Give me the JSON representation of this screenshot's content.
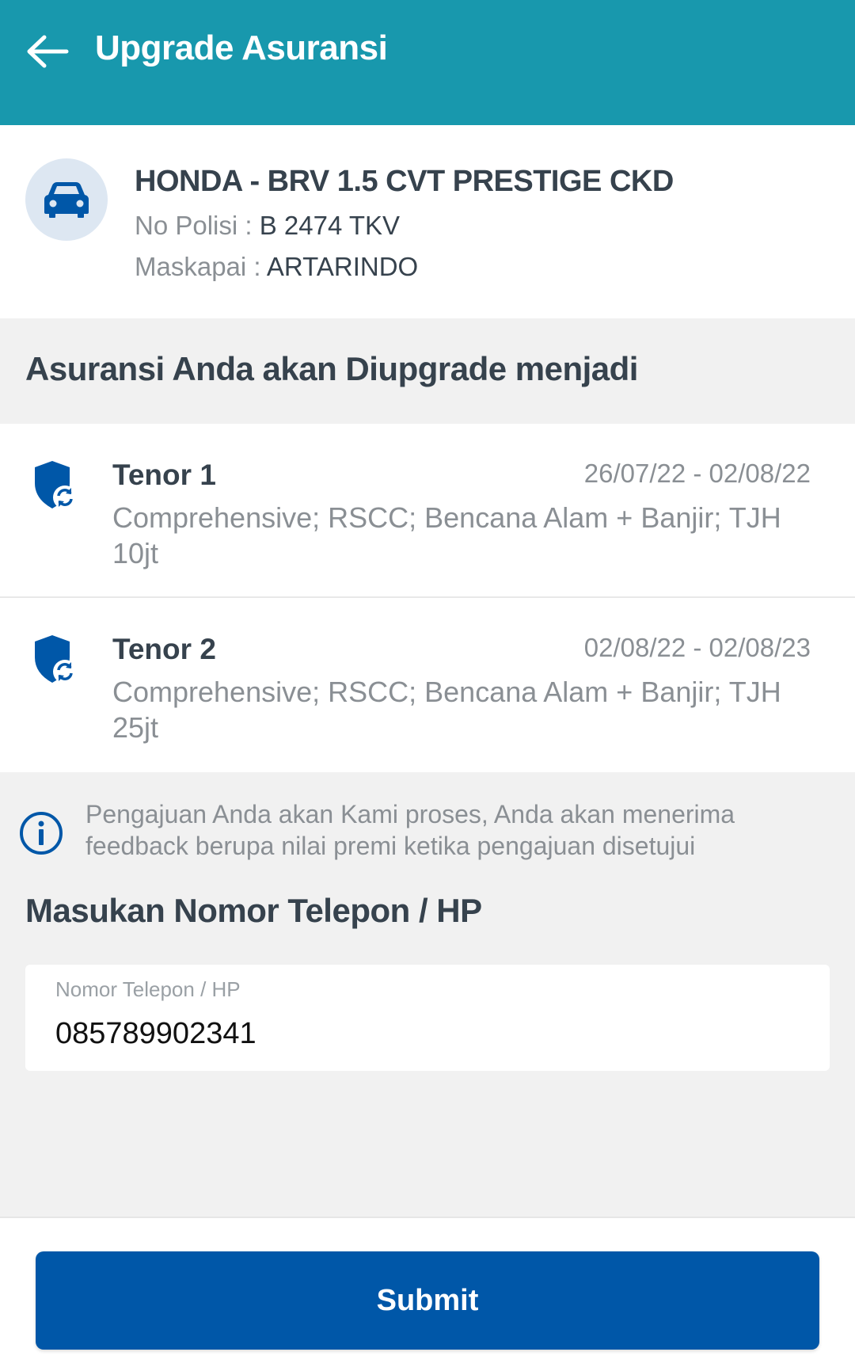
{
  "appbar": {
    "title": "Upgrade Asuransi",
    "background": "#1898ad"
  },
  "vehicle": {
    "icon": "car-icon",
    "name": "HONDA - BRV 1.5 CVT PRESTIGE CKD",
    "polisi_label": "No Polisi : ",
    "polisi_value": "B 2474 TKV",
    "maskapai_label": "Maskapai : ",
    "maskapai_value": "ARTARINDO"
  },
  "upgrade_section": {
    "title": "Asuransi Anda akan Diupgrade menjadi",
    "tenors": [
      {
        "icon": "shield-refresh-icon",
        "name": "Tenor 1",
        "date_range": "26/07/22 - 02/08/22",
        "description": "Comprehensive; RSCC; Bencana Alam + Banjir; TJH 10jt"
      },
      {
        "icon": "shield-refresh-icon",
        "name": "Tenor 2",
        "date_range": "02/08/22 - 02/08/23",
        "description": "Comprehensive; RSCC; Bencana Alam + Banjir; TJH 25jt"
      }
    ]
  },
  "info": {
    "icon": "info-icon",
    "text": "Pengajuan Anda akan Kami proses, Anda akan menerima feedback berupa nilai premi ketika pengajuan disetujui"
  },
  "phone": {
    "section_label": "Masukan Nomor Telepon / HP",
    "field_label": "Nomor Telepon / HP",
    "value": "085789902341"
  },
  "footer": {
    "submit_label": "Submit",
    "button_color": "#0057a8"
  }
}
